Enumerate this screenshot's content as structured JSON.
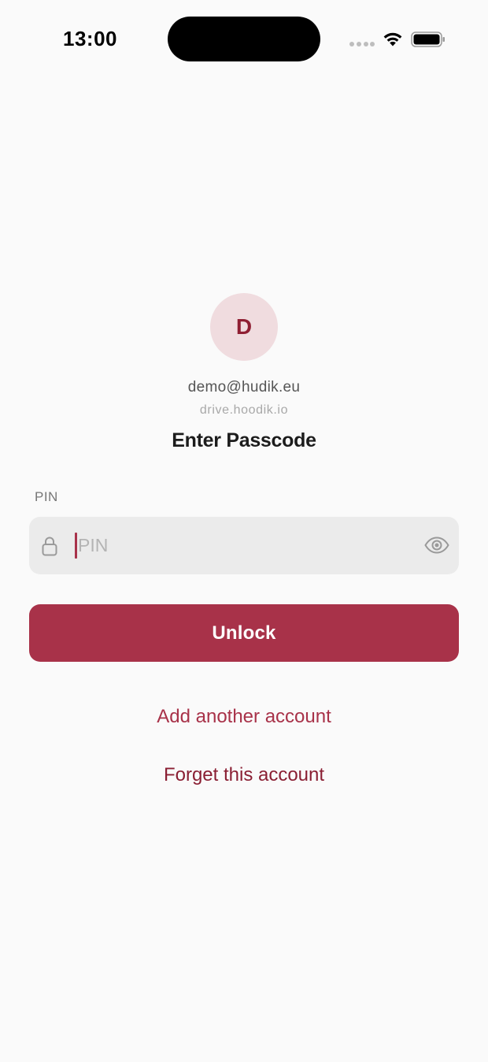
{
  "status_bar": {
    "time": "13:00"
  },
  "account": {
    "avatar_initial": "D",
    "email": "demo@hudik.eu",
    "server": "drive.hoodik.io"
  },
  "screen": {
    "title": "Enter Passcode"
  },
  "pin_field": {
    "label": "PIN",
    "placeholder": "PIN",
    "value": ""
  },
  "actions": {
    "unlock_label": "Unlock",
    "add_account_label": "Add another account",
    "forget_account_label": "Forget this account"
  },
  "icons": {
    "lock": "lock-icon",
    "eye": "eye-icon",
    "wifi": "wifi-icon",
    "battery": "battery-icon",
    "signal": "signal-icon"
  },
  "colors": {
    "accent": "#a83249",
    "accent_dark": "#8a1f33",
    "avatar_bg": "#f0dcdf",
    "field_bg": "#ebebeb",
    "background": "#fafafa"
  }
}
